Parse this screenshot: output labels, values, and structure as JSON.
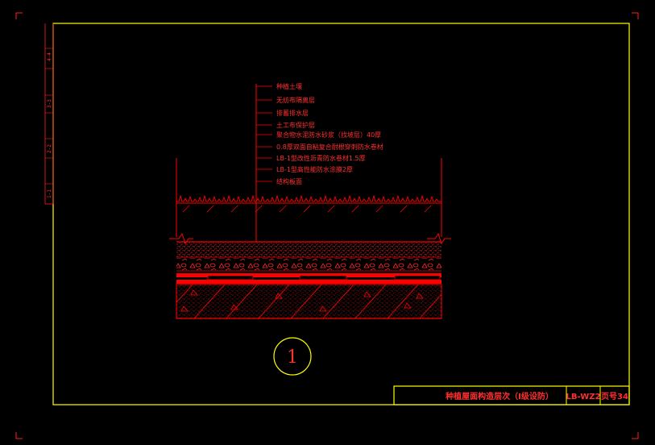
{
  "layer_labels": [
    "种植土壤",
    "无纺布隔离层",
    "排蓄排水层",
    "土工布保护层",
    "聚合物水泥防水砂浆（找坡层）40厚",
    "0.8厚双面自粘复合耐根穿刺防水卷材",
    "LB-1型改性沥青防水卷材1.5厚",
    "LB-1型高性能防水涂膜2厚",
    "结构板面"
  ],
  "title_block": {
    "title": "种植屋面构造层次（Ⅰ级设防）",
    "code": "LB-WZ2",
    "page": "页号34"
  },
  "detail_number": "1",
  "gutter_marks": [
    "4-4",
    "3-3",
    "2-2",
    "1-1"
  ],
  "colors": {
    "background": "#000000",
    "frame": "#ffff00",
    "drawing": "#ff0000",
    "outer_corners": "#ff2020"
  }
}
